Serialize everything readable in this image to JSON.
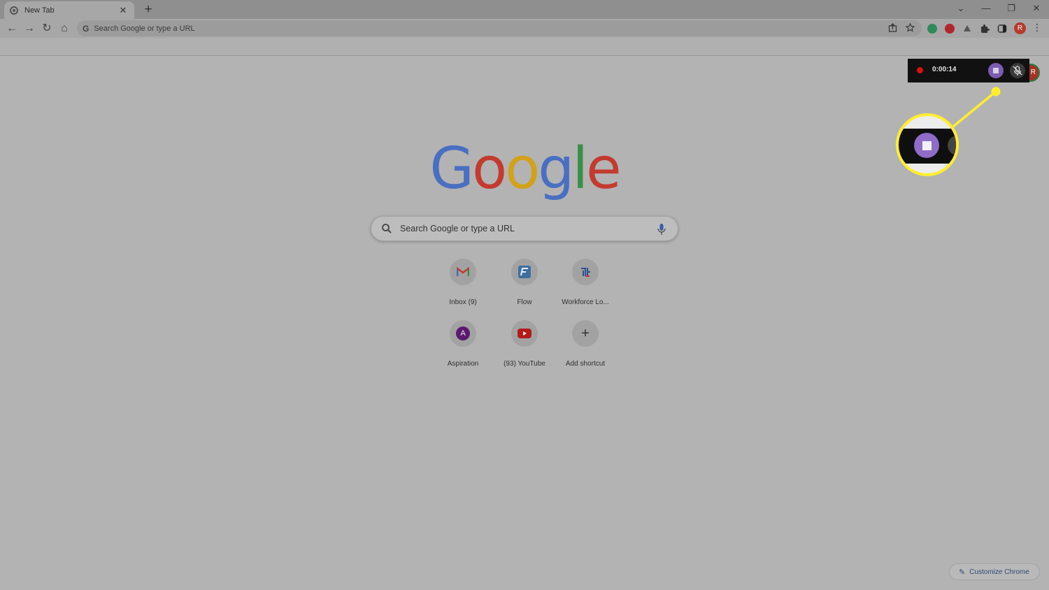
{
  "tab": {
    "title": "New Tab",
    "close_glyph": "✕"
  },
  "tabstrip": {
    "new_tab_glyph": "+",
    "tab_search_glyph": "⌄",
    "minimize_glyph": "—",
    "restore_glyph": "❐",
    "close_glyph": "✕"
  },
  "toolbar": {
    "back_glyph": "←",
    "forward_glyph": "→",
    "reload_glyph": "↻",
    "home_glyph": "⌂",
    "omnibox_placeholder": "Search Google or type a URL",
    "profile_initial": "R"
  },
  "logo": {
    "letters": [
      "G",
      "o",
      "o",
      "g",
      "l",
      "e"
    ],
    "colors": [
      "#4a6fc1",
      "#c33b30",
      "#d1a21a",
      "#4a6fc1",
      "#3a8f48",
      "#c33b30"
    ]
  },
  "search": {
    "placeholder": "Search Google or type a URL"
  },
  "shortcuts": [
    {
      "label": "Inbox (9)",
      "icon": "gmail-icon"
    },
    {
      "label": "Flow",
      "icon": "flow-icon"
    },
    {
      "label": "Workforce Lo...",
      "icon": "workforce-icon"
    },
    {
      "label": "Aspiration",
      "icon": "aspiration-icon",
      "initial": "A"
    },
    {
      "label": "(93) YouTube",
      "icon": "youtube-icon"
    },
    {
      "label": "Add shortcut",
      "icon": "plus-icon",
      "glyph": "+"
    }
  ],
  "recorder": {
    "elapsed": "0:00:14",
    "avatar_initial": "R"
  },
  "customize": {
    "label": "Customize Chrome",
    "glyph": "✎"
  },
  "colors": {
    "highlight": "#ffee2e",
    "record_dot": "#d90f0f",
    "stop_button": "#7c5cb0"
  }
}
